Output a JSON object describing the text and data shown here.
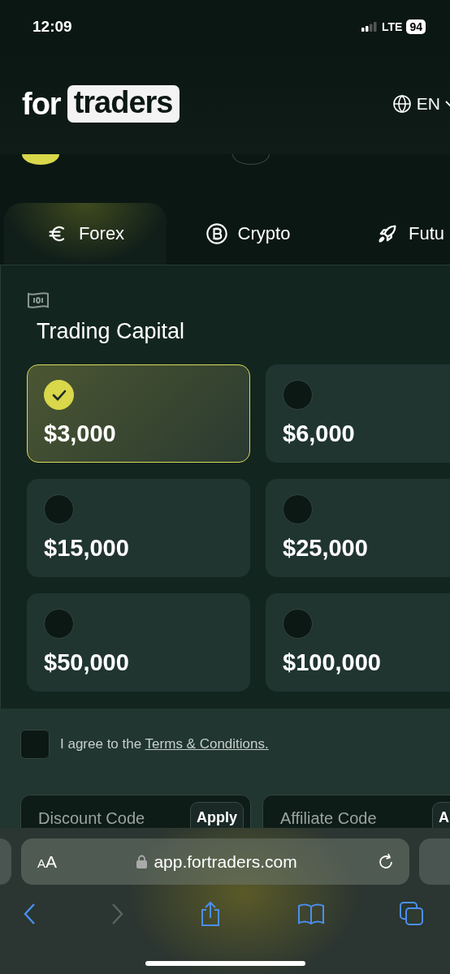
{
  "status_bar": {
    "time": "12:09",
    "network": "LTE",
    "battery": "94"
  },
  "header": {
    "logo_prefix": "for",
    "logo_highlight": "traders",
    "language": "EN"
  },
  "steps": [
    {
      "selected": true
    },
    {
      "selected": false
    }
  ],
  "tabs": [
    {
      "label": "Forex",
      "selected": true
    },
    {
      "label": "Crypto",
      "selected": false
    },
    {
      "label": "Futu",
      "selected": false
    }
  ],
  "trading_capital": {
    "title": "Trading Capital",
    "options": [
      {
        "amount": "$3,000",
        "selected": true
      },
      {
        "amount": "$6,000",
        "selected": false
      },
      {
        "amount": "$15,000",
        "selected": false
      },
      {
        "amount": "$25,000",
        "selected": false
      },
      {
        "amount": "$50,000",
        "selected": false
      },
      {
        "amount": "$100,000",
        "selected": false
      }
    ]
  },
  "agreement": {
    "checked": false,
    "text": "I agree to the",
    "link": "Terms & Conditions."
  },
  "code_fields": [
    {
      "placeholder": "Discount Code",
      "button": "Apply"
    },
    {
      "placeholder": "Affiliate Code",
      "button": "A"
    }
  ],
  "browser": {
    "text_size_button": "AA",
    "url": "app.fortraders.com",
    "forward_disabled": true
  }
}
